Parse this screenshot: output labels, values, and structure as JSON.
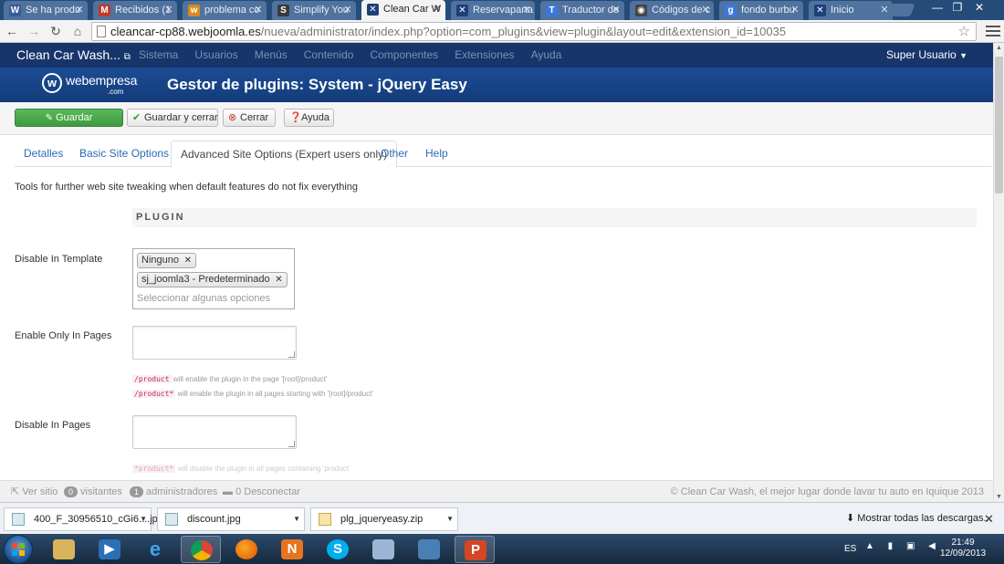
{
  "browser": {
    "tabs": [
      {
        "title": "Se ha produ",
        "active": false,
        "fav": "W",
        "fav_color": "#3a5a9a"
      },
      {
        "title": "Recibidos (1",
        "active": false,
        "fav": "M",
        "fav_color": "#c0392b"
      },
      {
        "title": "problema co",
        "active": false,
        "fav": "w",
        "fav_color": "#d98a1c"
      },
      {
        "title": "Simplify You",
        "active": false,
        "fav": "S",
        "fav_color": "#3a3a3a"
      },
      {
        "title": "Clean Car W",
        "active": true,
        "fav": "✕",
        "fav_color": "#1f3f7a"
      },
      {
        "title": "Reservaparta",
        "active": false,
        "fav": "✕",
        "fav_color": "#1f3f7a"
      },
      {
        "title": "Traductor de",
        "active": false,
        "fav": "T",
        "fav_color": "#3b78d8"
      },
      {
        "title": "Códigos de c",
        "active": false,
        "fav": "◉",
        "fav_color": "#444"
      },
      {
        "title": "fondo burbu",
        "active": false,
        "fav": "g",
        "fav_color": "#3b78d8"
      },
      {
        "title": "Inicio",
        "active": false,
        "fav": "✕",
        "fav_color": "#1f3f7a"
      }
    ],
    "url_host": "cleancar-cp88.webjoomla.es",
    "url_rest": "/nueva/administrator/index.php?option=com_plugins&view=plugin&layout=edit&extension_id=10035"
  },
  "admin": {
    "brand": "Clean Car Wash...",
    "brand_icon": "external-link-icon",
    "menu": [
      "Sistema",
      "Usuarios",
      "Menús",
      "Contenido",
      "Componentes",
      "Extensiones",
      "Ayuda"
    ],
    "user": "Super Usuario",
    "logo_text": "webempresa",
    "logo_sub": ".com",
    "page_title": "Gestor de plugins: System - jQuery Easy"
  },
  "toolbar": {
    "save": "Guardar",
    "save_close": "Guardar y cerrar",
    "close": "Cerrar",
    "help": "Ayuda"
  },
  "tabs": [
    "Detalles",
    "Basic Site Options",
    "Advanced Site Options (Expert users only)",
    "Other",
    "Help"
  ],
  "active_tab": 2,
  "content": {
    "description": "Tools for further web site tweaking when default features do not fix everything",
    "section_title": "PLUGIN",
    "disable_in_template": {
      "label": "Disable In Template",
      "chips": [
        "Ninguno",
        "sj_joomla3 - Predeterminado"
      ],
      "placeholder": "Seleccionar algunas opciones"
    },
    "enable_only_in_pages": {
      "label": "Enable Only In Pages",
      "hints": [
        {
          "code": "/product",
          "text": "will enable the plugin in the page '[root]/product'"
        },
        {
          "code": "/product*",
          "text": "will enable the plugin in all pages starting with '[root]/product'"
        }
      ]
    },
    "disable_in_pages": {
      "label": "Disable In Pages",
      "hints": [
        {
          "code": "*product*",
          "text": "will disable the plugin in all pages containing 'product'"
        }
      ]
    }
  },
  "statusbar": {
    "view_site": "Ver sitio",
    "visitors_count": "0",
    "visitors_label": "visitantes",
    "admins_count": "1",
    "admins_label": "administradores",
    "logout_count": "0",
    "logout_label": "Desconectar",
    "copyright": "© Clean Car Wash, el mejor lugar donde lavar tu auto en Iquique 2013"
  },
  "downloads": {
    "items": [
      "400_F_30956510_cGi6....jpg",
      "discount.jpg",
      "plg_jqueryeasy.zip"
    ],
    "show_all": "Mostrar todas las descargas..."
  },
  "taskbar": {
    "lang": "ES",
    "time": "21:49",
    "date": "12/09/2013"
  }
}
